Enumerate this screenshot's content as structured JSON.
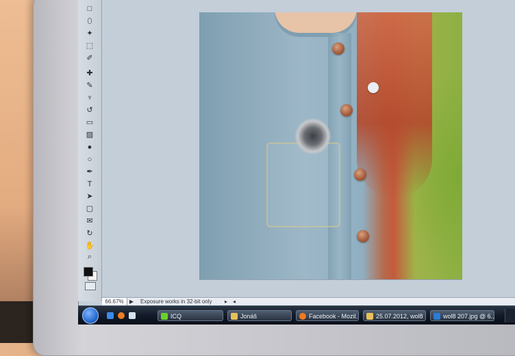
{
  "workspace": {
    "zoom_level": "66.67%",
    "status_message": "Exposure works in 32-bit only",
    "status_arrow": "▶",
    "status_next": "▸",
    "status_prev": "◂"
  },
  "toolbox": {
    "icons": [
      "marquee-icon",
      "lasso-icon",
      "magic-wand-icon",
      "crop-icon",
      "eyedropper-icon",
      "healing-brush-icon",
      "brush-icon",
      "clone-stamp-icon",
      "history-brush-icon",
      "eraser-icon",
      "gradient-icon",
      "blur-icon",
      "dodge-icon",
      "pen-icon",
      "type-icon",
      "path-selection-icon",
      "shape-icon",
      "notes-icon",
      "3d-rotate-icon",
      "hand-icon",
      "zoom-icon"
    ],
    "glyphs": [
      "□",
      "⬯",
      "✦",
      "⬚",
      "✐",
      "✚",
      "✎",
      "♆",
      "↺",
      "▭",
      "▨",
      "●",
      "○",
      "✒",
      "T",
      "➤",
      "▢",
      "✉",
      "↻",
      "✋",
      "⌕"
    ],
    "foreground_color": "#101012",
    "background_color": "#f4f4f6"
  },
  "taskbar": {
    "items": [
      {
        "label": "ICQ",
        "icon": "icq-icon",
        "color": "#6bd12e"
      },
      {
        "label": "Jonáš",
        "icon": "folder-icon",
        "color": "#e6c15a"
      },
      {
        "label": "Facebook - Mozil...",
        "icon": "firefox-icon",
        "color": "#f07a1f"
      },
      {
        "label": "25.07.2012, wol8",
        "icon": "folder-icon",
        "color": "#e6c15a"
      },
      {
        "label": "wol8 207.jpg @ 6...",
        "icon": "photoshop-icon",
        "color": "#2c7bd6"
      }
    ]
  },
  "colors": {
    "screen_bg": "#c6d0da",
    "taskbar_bg": "#111826"
  }
}
